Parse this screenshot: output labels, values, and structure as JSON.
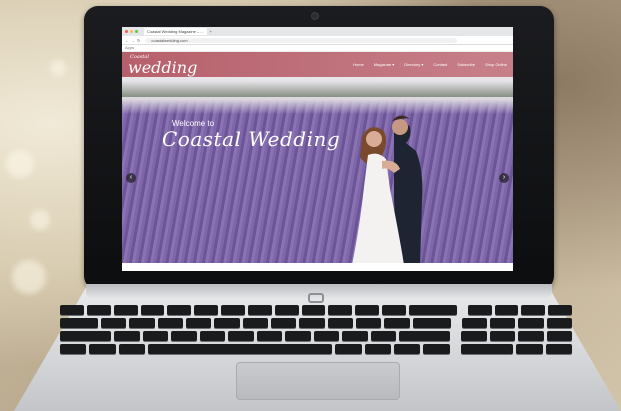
{
  "browser": {
    "tab_title": "Coastal Wedding Magazine – ...",
    "url": "coastalwedding.com",
    "bookmark": "Apps"
  },
  "site": {
    "logo_small": "Coastal",
    "logo": "wedding",
    "menu": [
      "Home",
      "Magazine ▾",
      "Directory ▾",
      "Contact",
      "Subscribe",
      "Shop Online"
    ]
  },
  "hero": {
    "welcome": "Welcome to",
    "title": "Coastal Wedding",
    "prev_icon": "chevron-left-icon",
    "next_icon": "chevron-right-icon"
  },
  "colors": {
    "brand": "#b6606b",
    "lavender": "#7b66a6"
  }
}
